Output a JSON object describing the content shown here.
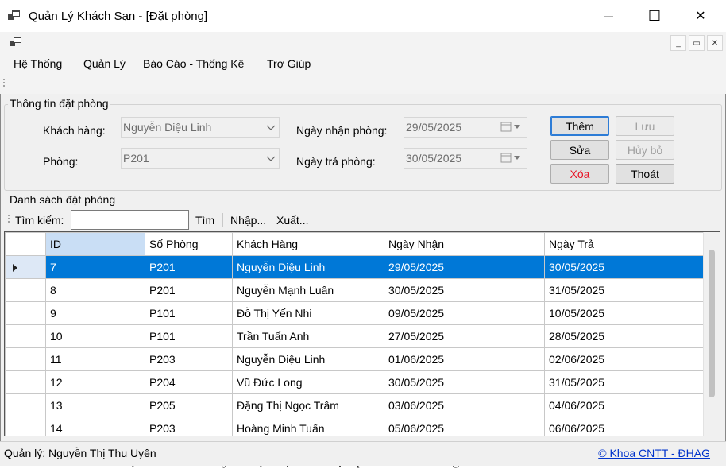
{
  "window": {
    "title": "Quản Lý Khách Sạn - [Đặt phòng]",
    "app_icon": "app-windows-icon",
    "minimize": "—",
    "maximize": "☐",
    "close": "✕"
  },
  "mdi": {
    "minimize": "_",
    "restore": "▭",
    "close": "✕"
  },
  "menu": {
    "items": [
      "Hệ Thống",
      "Quản Lý",
      "Báo Cáo - Thống Kê",
      "Trợ Giúp"
    ]
  },
  "info_group": {
    "title": "Thông tin đặt phòng",
    "customer_label": "Khách hàng:",
    "customer_value": "Nguyễn Diệu Linh",
    "room_label": "Phòng:",
    "room_value": "P201",
    "checkin_label": "Ngày nhận phòng:",
    "checkin_value": "29/05/2025",
    "checkout_label": "Ngày trả phòng:",
    "checkout_value": "30/05/2025"
  },
  "buttons": {
    "add": "Thêm",
    "save": "Lưu",
    "edit": "Sửa",
    "cancel": "Hủy bỏ",
    "delete": "Xóa",
    "exit": "Thoát"
  },
  "list_group": {
    "title": "Danh sách đặt phòng",
    "search_label": "Tìm kiếm:",
    "search_value": "",
    "search_button": "Tìm",
    "import_button": "Nhập...",
    "export_button": "Xuất..."
  },
  "table": {
    "columns": [
      "ID",
      "Số Phòng",
      "Khách Hàng",
      "Ngày Nhận",
      "Ngày Trả"
    ],
    "rows": [
      [
        "7",
        "P201",
        "Nguyễn Diệu Linh",
        "29/05/2025",
        "30/05/2025"
      ],
      [
        "8",
        "P201",
        "Nguyễn Mạnh Luân",
        "30/05/2025",
        "31/05/2025"
      ],
      [
        "9",
        "P101",
        "Đỗ Thị Yến Nhi",
        "09/05/2025",
        "10/05/2025"
      ],
      [
        "10",
        "P101",
        "Trần Tuấn Anh",
        "27/05/2025",
        "28/05/2025"
      ],
      [
        "11",
        "P203",
        "Nguyễn Diệu Linh",
        "01/06/2025",
        "02/06/2025"
      ],
      [
        "12",
        "P204",
        "Vũ Đức Long",
        "30/05/2025",
        "31/05/2025"
      ],
      [
        "13",
        "P205",
        "Đặng Thị Ngọc Trâm",
        "03/06/2025",
        "04/06/2025"
      ],
      [
        "14",
        "P203",
        "Hoàng Minh Tuấn",
        "05/06/2025",
        "06/06/2025"
      ]
    ],
    "selected_row": 0
  },
  "status": {
    "manager": "Quản lý: Nguyễn Thị Thu Uyên",
    "link": "© Khoa CNTT - ĐHAG"
  },
  "background_text": "việc lưu trữ và xử lý dữ liệu một cách hiệu quả. Các chức năng chính bao",
  "colors": {
    "selection": "#0078d7",
    "delete_text": "#e81123",
    "link": "#0033cc",
    "sorted_header": "#c9def5"
  }
}
